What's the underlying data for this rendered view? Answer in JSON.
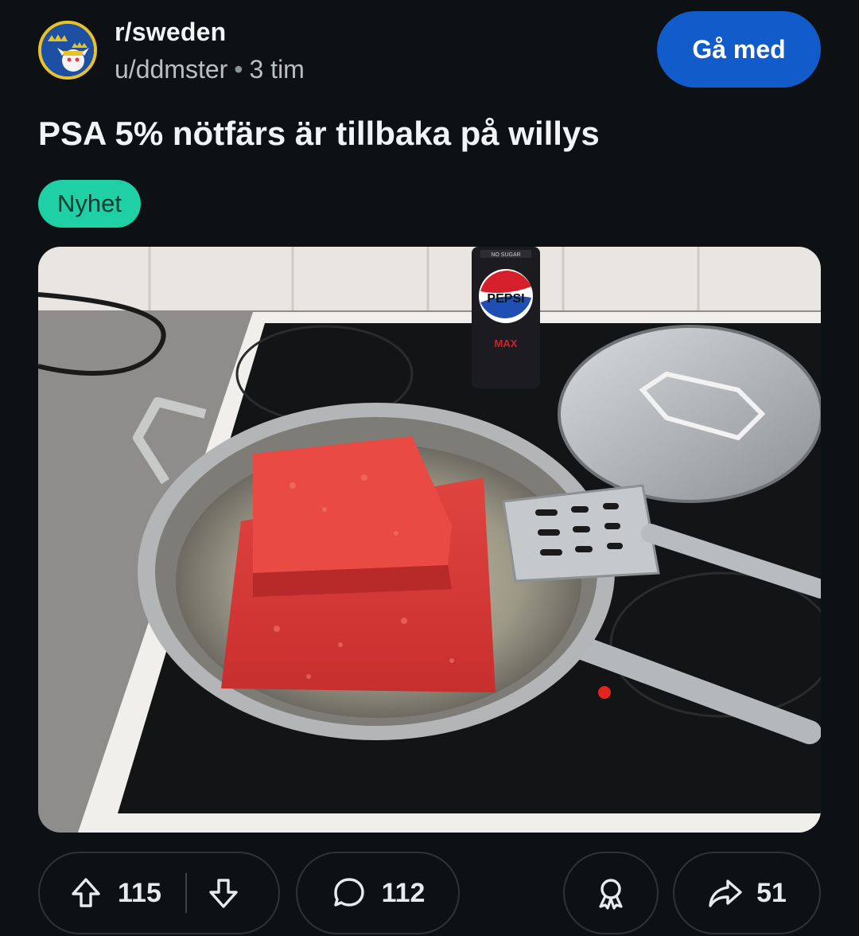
{
  "header": {
    "subreddit": "r/sweden",
    "author": "u/ddmster",
    "separator": "•",
    "time": "3 tim",
    "join_label": "Gå med"
  },
  "post": {
    "title": "PSA 5% nötfärs är tillbaka på willys",
    "flair": "Nyhet",
    "flair_color": "#1fcfa6"
  },
  "image": {
    "can_label": "PEPSI",
    "can_sublabel": "MAX",
    "can_top_text": "NO SUGAR"
  },
  "actions": {
    "upvotes": "115",
    "comments": "112",
    "shares": "51"
  },
  "colors": {
    "background": "#0e1113",
    "join_button": "#115bca",
    "text": "#f2f4f5",
    "muted": "#b7c0c5"
  },
  "icons": [
    "subreddit-avatar",
    "upvote-icon",
    "downvote-icon",
    "comment-icon",
    "award-icon",
    "share-icon"
  ]
}
